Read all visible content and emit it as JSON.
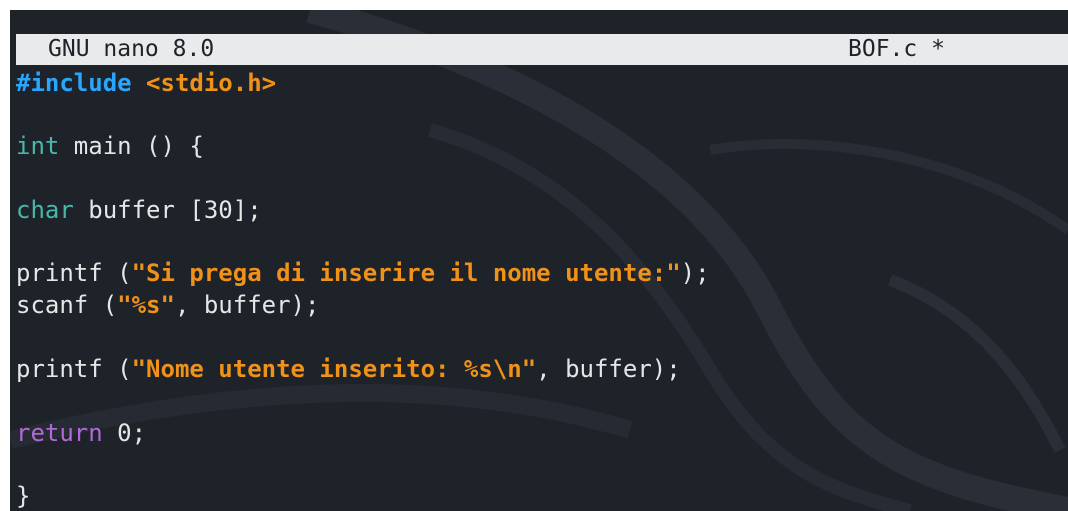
{
  "titlebar": {
    "app": "GNU nano 8.0",
    "file": "BOF.c *"
  },
  "code": {
    "line1": {
      "directive": "#include",
      "header": "<stdio.h>"
    },
    "line3": {
      "type": "int",
      "rest": " main () {"
    },
    "line5": {
      "type": "char",
      "rest": " buffer [30];"
    },
    "line7": {
      "pre": "printf (",
      "str": "\"Si prega di inserire il nome utente:\"",
      "post": ");"
    },
    "line8": {
      "pre": "scanf (",
      "str": "\"%s\"",
      "post": ", buffer);"
    },
    "line10": {
      "pre": "printf (",
      "str": "\"Nome utente inserito: %s\\n\"",
      "post": ", buffer);"
    },
    "line12": {
      "kw": "return",
      "rest": " 0;"
    },
    "line14": {
      "text": "}"
    }
  },
  "colors": {
    "background": "#1e2229",
    "titlebar": "#e9eaec",
    "preprocessor": "#2aa6ff",
    "string": "#f0921a",
    "type": "#47b8a9",
    "return": "#b069d6"
  }
}
